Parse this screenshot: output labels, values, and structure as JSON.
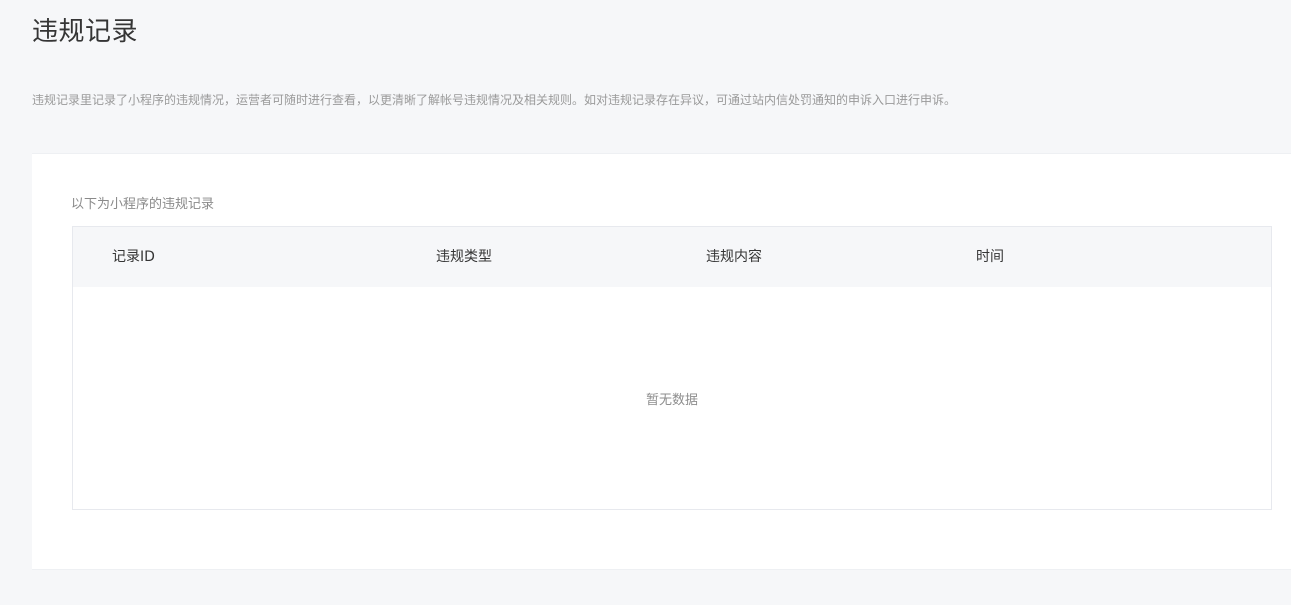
{
  "header": {
    "title": "违规记录",
    "description": "违规记录里记录了小程序的违规情况，运营者可随时进行查看，以更清晰了解帐号违规情况及相关规则。如对违规记录存在异议，可通过站内信处罚通知的申诉入口进行申诉。"
  },
  "records": {
    "caption": "以下为小程序的违规记录",
    "columns": [
      "记录ID",
      "违规类型",
      "违规内容",
      "时间"
    ],
    "rows": [],
    "empty_text": "暂无数据"
  }
}
